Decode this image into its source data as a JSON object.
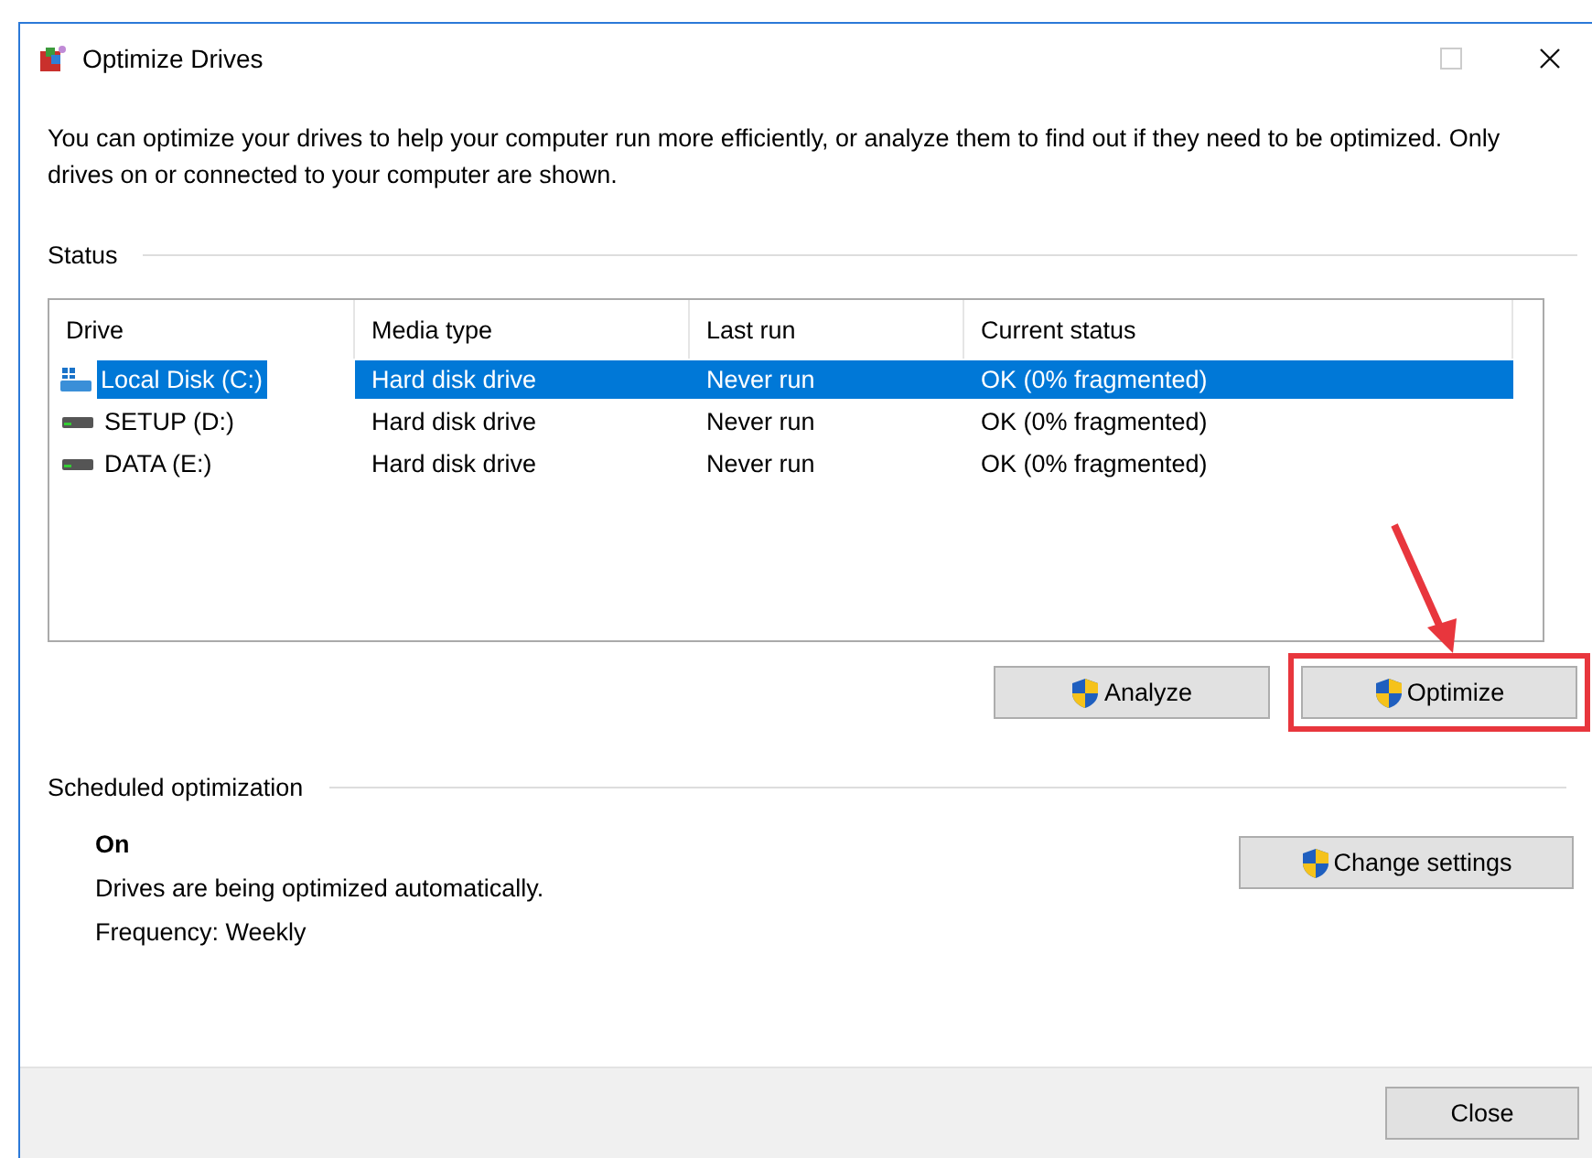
{
  "window": {
    "title": "Optimize Drives"
  },
  "description": "You can optimize your drives to help your computer run more efficiently, or analyze them to find out if they need to be optimized. Only drives on or connected to your computer are shown.",
  "status": {
    "label": "Status",
    "columns": [
      "Drive",
      "Media type",
      "Last run",
      "Current status"
    ],
    "rows": [
      {
        "kind": "system",
        "drive": "Local Disk (C:)",
        "media_type": "Hard disk drive",
        "last_run": "Never run",
        "current_status": "OK (0% fragmented)",
        "selected": true
      },
      {
        "kind": "disk",
        "drive": "SETUP (D:)",
        "media_type": "Hard disk drive",
        "last_run": "Never run",
        "current_status": "OK (0% fragmented)",
        "selected": false
      },
      {
        "kind": "disk",
        "drive": "DATA (E:)",
        "media_type": "Hard disk drive",
        "last_run": "Never run",
        "current_status": "OK (0% fragmented)",
        "selected": false
      }
    ],
    "buttons": [
      {
        "label": "Analyze",
        "highlighted": false
      },
      {
        "label": "Optimize",
        "highlighted": true
      }
    ]
  },
  "scheduled": {
    "label": "Scheduled optimization",
    "state": "On",
    "note": "Drives are being optimized automatically.",
    "frequency": "Frequency: Weekly",
    "button": "Change settings"
  },
  "footer": {
    "button": "Close"
  }
}
